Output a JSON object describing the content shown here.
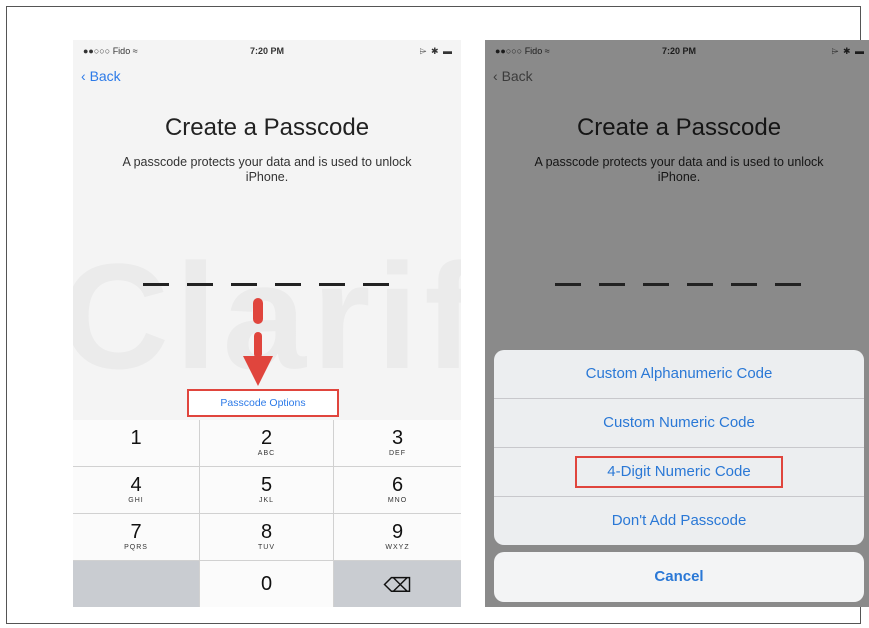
{
  "status_bar": {
    "carrier": "Fido",
    "time": "7:20 PM",
    "icons": "⌲ ✱ ▬"
  },
  "nav": {
    "back_label": "Back"
  },
  "screen": {
    "title": "Create a Passcode",
    "subtitle": "A passcode protects your data and is used to unlock iPhone."
  },
  "watermark": "iClarified",
  "passcode_options_label": "Passcode Options",
  "keypad": [
    {
      "digit": "1",
      "letters": ""
    },
    {
      "digit": "2",
      "letters": "ABC"
    },
    {
      "digit": "3",
      "letters": "DEF"
    },
    {
      "digit": "4",
      "letters": "GHI"
    },
    {
      "digit": "5",
      "letters": "JKL"
    },
    {
      "digit": "6",
      "letters": "MNO"
    },
    {
      "digit": "7",
      "letters": "PQRS"
    },
    {
      "digit": "8",
      "letters": "TUV"
    },
    {
      "digit": "9",
      "letters": "WXYZ"
    },
    {
      "digit": "0",
      "letters": ""
    },
    {
      "digit": "⌫",
      "letters": ""
    }
  ],
  "action_sheet": {
    "options": [
      "Custom Alphanumeric Code",
      "Custom Numeric Code",
      "4-Digit Numeric Code",
      "Don't Add Passcode"
    ],
    "cancel": "Cancel"
  },
  "colors": {
    "ios_blue": "#2c7ae8",
    "highlight_red": "#e0453d",
    "dim_overlay": "#8a8a8a"
  }
}
